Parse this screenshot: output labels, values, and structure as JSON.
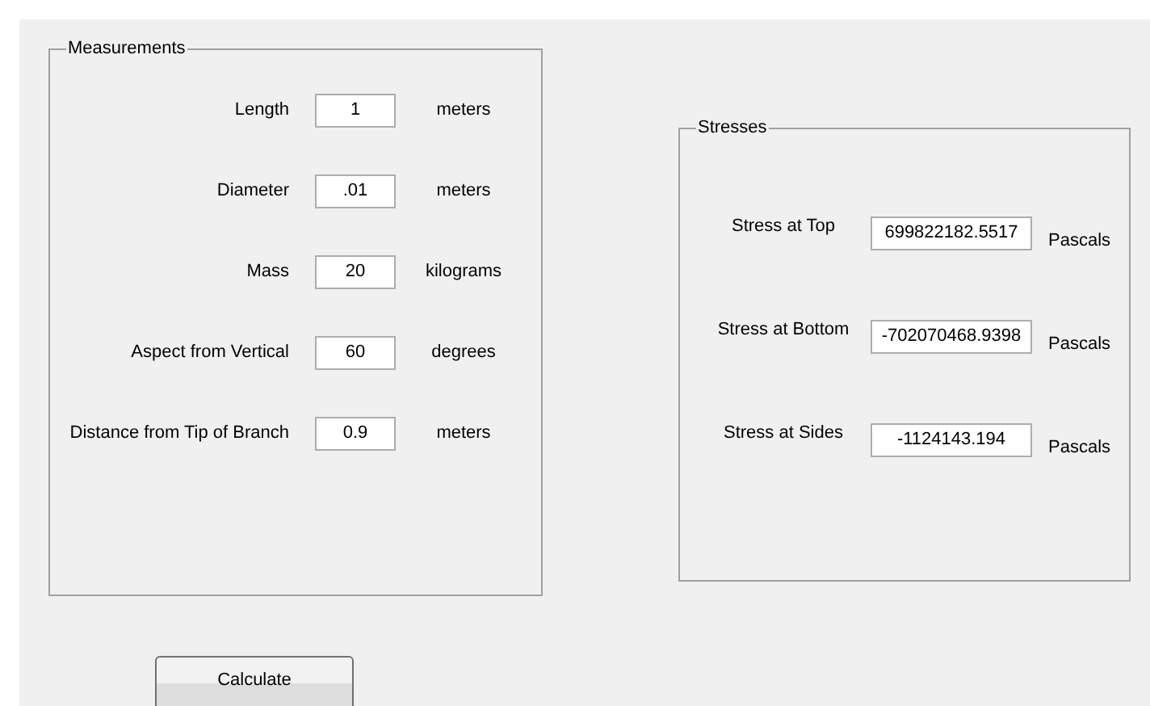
{
  "measurements": {
    "title": "Measurements",
    "rows": [
      {
        "label": "Length",
        "value": "1",
        "unit": "meters"
      },
      {
        "label": "Diameter",
        "value": ".01",
        "unit": "meters"
      },
      {
        "label": "Mass",
        "value": "20",
        "unit": "kilograms"
      },
      {
        "label": "Aspect from Vertical",
        "value": "60",
        "unit": "degrees"
      },
      {
        "label": "Distance from Tip of Branch",
        "value": "0.9",
        "unit": "meters"
      }
    ]
  },
  "stresses": {
    "title": "Stresses",
    "rows": [
      {
        "label": "Stress at Top",
        "value": "699822182.5517",
        "unit": "Pascals"
      },
      {
        "label": "Stress at Bottom",
        "value": "-702070468.9398",
        "unit": "Pascals"
      },
      {
        "label": "Stress at Sides",
        "value": "-1124143.194",
        "unit": "Pascals"
      }
    ]
  },
  "button": {
    "label": "Calculate"
  }
}
